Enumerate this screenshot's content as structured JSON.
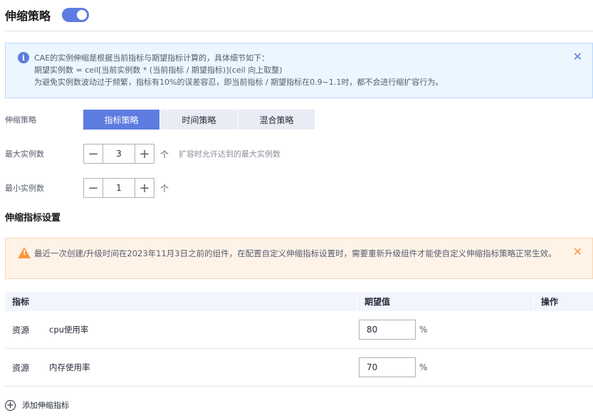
{
  "header": {
    "title": "伸缩策略",
    "toggle_on": true
  },
  "info_alert": {
    "line1": "CAE的实例伸缩是根据当前指标与期望指标计算的，具体细节如下：",
    "line2": "期望实例数 = ceil[当前实例数 * (当前指标 / 期望指标)](ceil 向上取整)",
    "line3": "为避免实例数波动过于频繁，指标有10%的误差容忍，即当前指标 / 期望指标在0.9~1.1时，都不会进行缩扩容行为。",
    "close": "✕"
  },
  "strategy": {
    "label": "伸缩策略",
    "options": [
      "指标策略",
      "时间策略",
      "混合策略"
    ],
    "selected": "指标策略"
  },
  "max_instances": {
    "label": "最大实例数",
    "value": "3",
    "unit": "个",
    "hint": "扩容时允许达到的最大实例数"
  },
  "min_instances": {
    "label": "最小实例数",
    "value": "1",
    "unit": "个"
  },
  "metrics_section": {
    "title": "伸缩指标设置"
  },
  "warn_alert": {
    "text": "最近一次创建/升级时间在2023年11月3日之前的组件，在配置自定义伸缩指标设置时，需要重新升级组件才能使自定义伸缩指标策略正常生效。",
    "close": "✕"
  },
  "table": {
    "headers": [
      "指标",
      "期望值",
      "操作"
    ],
    "rows": [
      {
        "type": "资源",
        "name": "cpu使用率",
        "value": "80",
        "unit": "%"
      },
      {
        "type": "资源",
        "name": "内存使用率",
        "value": "70",
        "unit": "%"
      }
    ]
  },
  "add_metric": {
    "label": "添加伸缩指标"
  },
  "colors": {
    "accent": "#5e7ce0",
    "warning": "#fa9841"
  }
}
